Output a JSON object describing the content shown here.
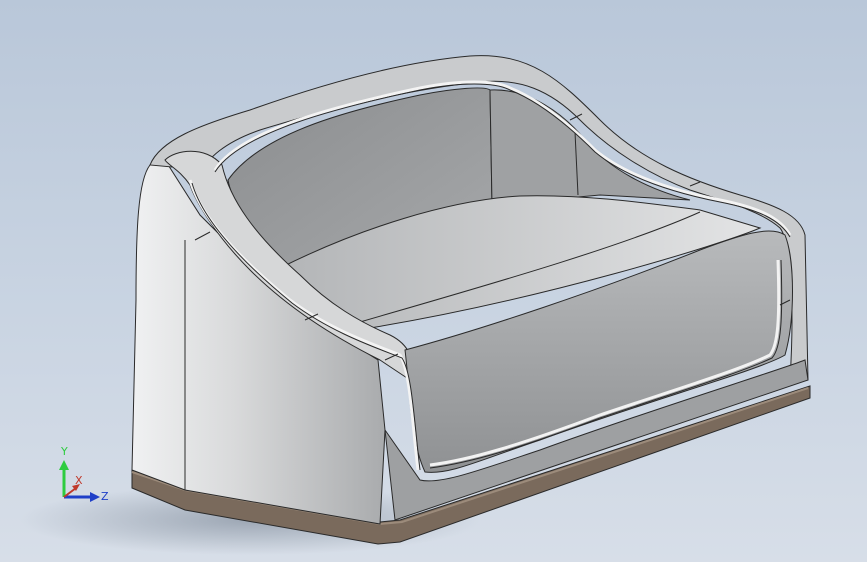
{
  "viewport": {
    "background_top": "#b9c7d9",
    "background_bottom": "#d7dee8"
  },
  "model": {
    "body_color": "#c4c6c8",
    "edge_color": "#2a2a2a",
    "base_strip_color": "#7a6a5c"
  },
  "triad": {
    "x_label": "X",
    "y_label": "Y",
    "z_label": "Z",
    "x_color": "#c0392b",
    "y_color": "#2ecc40",
    "z_color": "#1f3fc8"
  }
}
